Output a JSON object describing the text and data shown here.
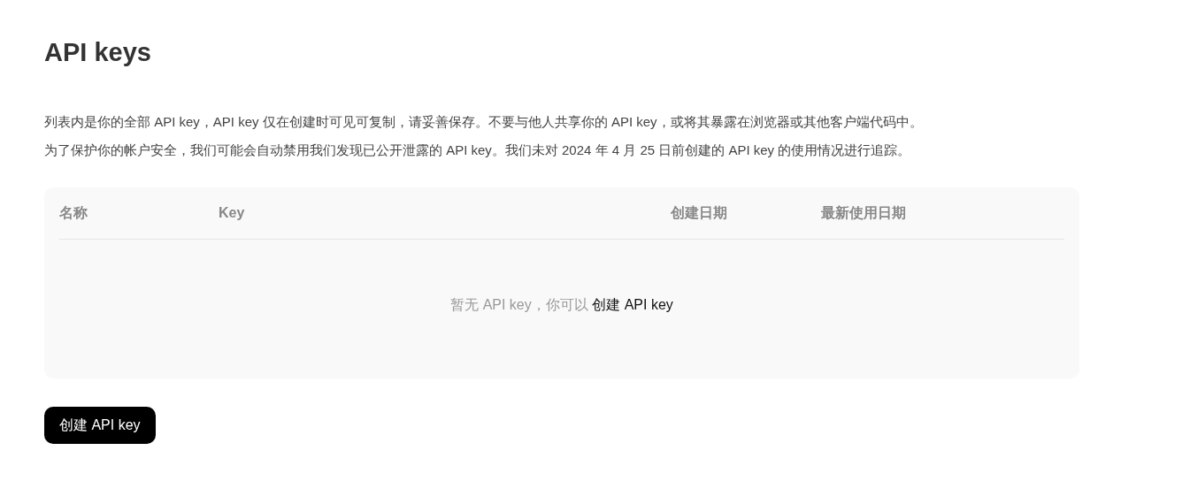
{
  "title": "API keys",
  "description": [
    "列表内是你的全部 API key，API key 仅在创建时可见可复制，请妥善保存。不要与他人共享你的 API key，或将其暴露在浏览器或其他客户端代码中。",
    "为了保护你的帐户安全，我们可能会自动禁用我们发现已公开泄露的 API key。我们未对 2024 年 4 月 25 日前创建的 API key 的使用情况进行追踪。"
  ],
  "table": {
    "columns": [
      "名称",
      "Key",
      "创建日期",
      "最新使用日期"
    ],
    "empty_state": {
      "text": "暂无 API key，你可以",
      "link": "创建 API key"
    }
  },
  "create_button": "创建 API key"
}
